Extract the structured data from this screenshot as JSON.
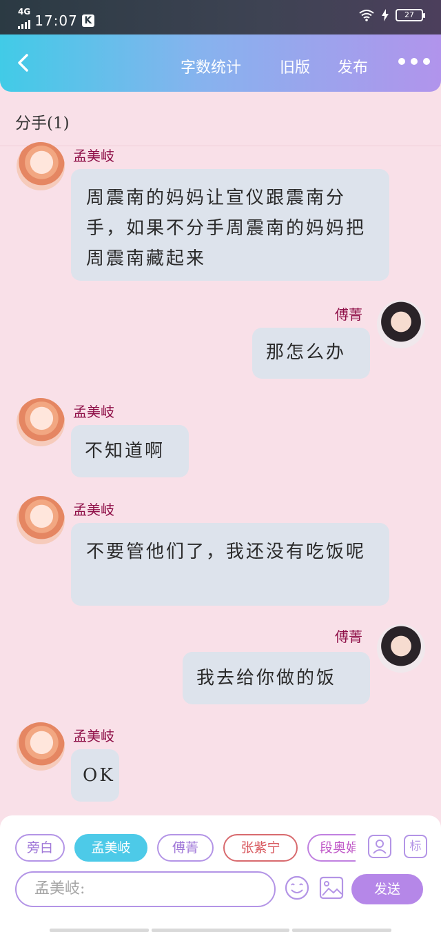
{
  "status_bar": {
    "network": "4G",
    "time": "17:07",
    "app_badge": "K",
    "battery": "27"
  },
  "header": {
    "word_count": "字数统计",
    "old_version": "旧版",
    "publish": "发布"
  },
  "chapter": {
    "title": "分手(1)"
  },
  "messages": [
    {
      "speaker": "孟美岐",
      "side": "left",
      "text": "周震南的妈妈让宣仪跟震南分手，如果不分手周震南的妈妈把周震南藏起来"
    },
    {
      "speaker": "傅菁",
      "side": "right",
      "text": "那怎么办"
    },
    {
      "speaker": "孟美岐",
      "side": "left",
      "text": "不知道啊"
    },
    {
      "speaker": "孟美岐",
      "side": "left",
      "text": "不要管他们了，我还没有吃饭呢"
    },
    {
      "speaker": "傅菁",
      "side": "right",
      "text": "我去给你做的饭"
    },
    {
      "speaker": "孟美岐",
      "side": "left",
      "text": "OK"
    }
  ],
  "composer": {
    "roles": [
      "旁白",
      "孟美岐",
      "傅菁",
      "张紫宁",
      "段奥娟"
    ],
    "active_role": "孟美岐",
    "avatar_button": "avatar-edit-icon",
    "tag_button": "标",
    "input_placeholder": "孟美岐:",
    "send_label": "发送"
  },
  "colors": {
    "background": "#f9e0e8",
    "header_gradient_start": "#41cbe7",
    "header_gradient_end": "#b194ec",
    "bubble": "#dde3ec",
    "speaker_name": "#8f1048",
    "accent": "#b587e8"
  }
}
